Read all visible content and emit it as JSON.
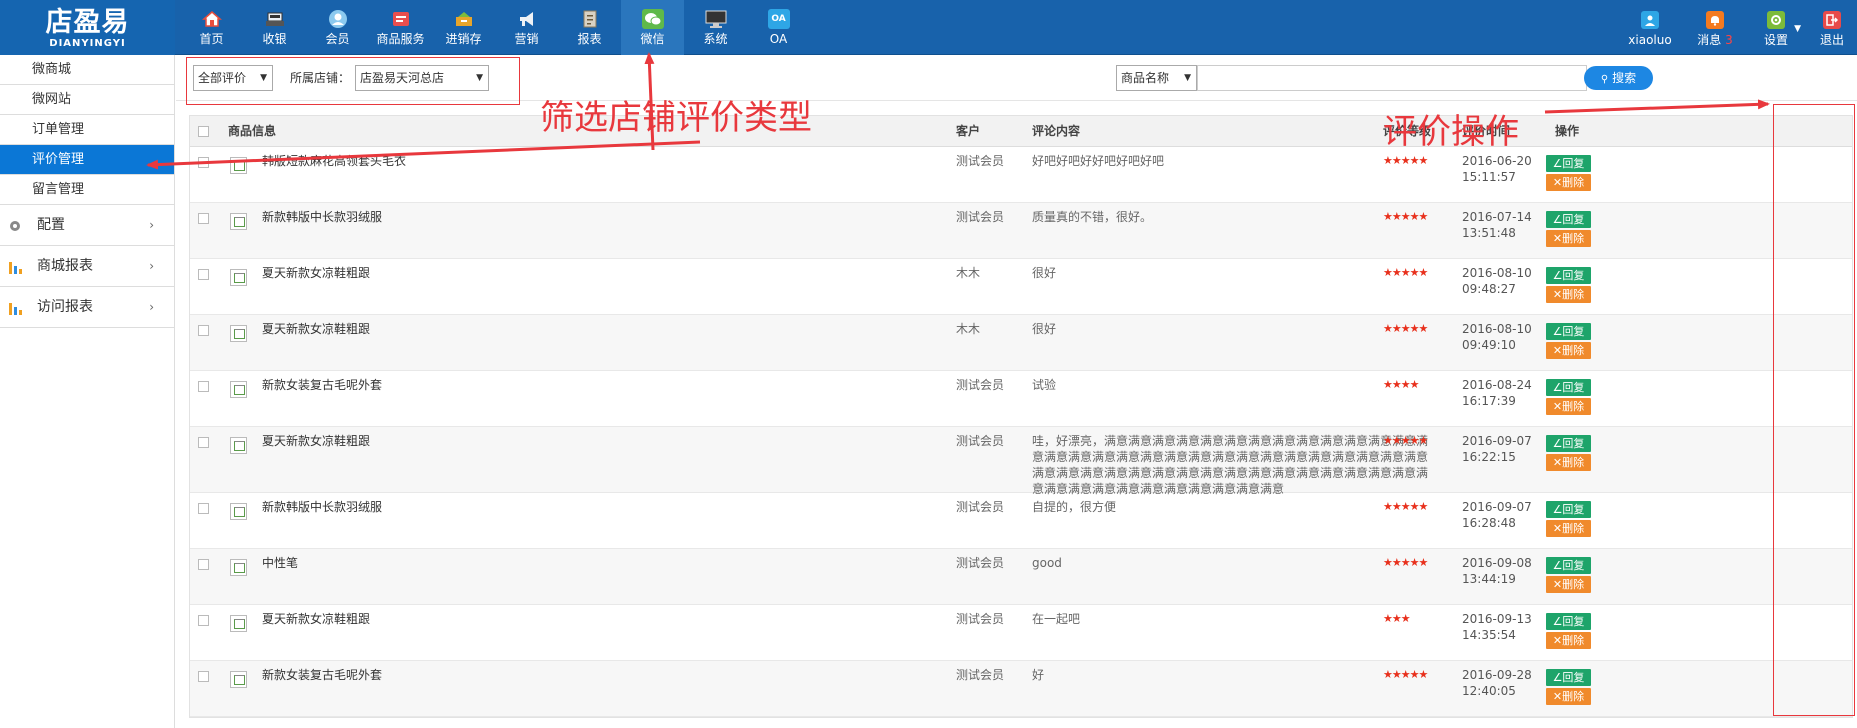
{
  "logo": {
    "cn": "店盈易",
    "en": "DIANYINGYI"
  },
  "nav": [
    {
      "label": "首页",
      "icon": "home-icon",
      "color": "#e94e3c"
    },
    {
      "label": "收银",
      "icon": "cash-register-icon",
      "color": "#dfe6ee"
    },
    {
      "label": "会员",
      "icon": "member-icon",
      "color": "#7fc0e8"
    },
    {
      "label": "商品服务",
      "icon": "goods-icon",
      "color": "#e94e4e"
    },
    {
      "label": "进销存",
      "icon": "inventory-icon",
      "color": "#e8a52a"
    },
    {
      "label": "营销",
      "icon": "megaphone-icon",
      "color": "#eef2f6"
    },
    {
      "label": "报表",
      "icon": "report-icon",
      "color": "#d9d2c4"
    },
    {
      "label": "微信",
      "icon": "wechat-icon",
      "color": "#5fb94a"
    },
    {
      "label": "系统",
      "icon": "monitor-icon",
      "color": "#333333"
    },
    {
      "label": "OA",
      "icon": "oa-icon",
      "color": "#2ea6e6"
    }
  ],
  "user": {
    "name": "xiaoluo",
    "messages_label": "消息",
    "messages_count": "3",
    "settings_label": "设置",
    "logout_label": "退出"
  },
  "sidebar": {
    "items": [
      {
        "label": "微商城",
        "active": false
      },
      {
        "label": "微网站",
        "active": false
      },
      {
        "label": "订单管理",
        "active": false
      },
      {
        "label": "评价管理",
        "active": true
      },
      {
        "label": "留言管理",
        "active": false
      }
    ],
    "groups": [
      {
        "label": "配置",
        "icon": "gear-icon"
      },
      {
        "label": "商城报表",
        "icon": "bar-chart-icon"
      },
      {
        "label": "访问报表",
        "icon": "bar-chart-icon"
      }
    ]
  },
  "filters": {
    "rating_type": "全部评价",
    "store_label": "所属店铺：",
    "store_value": "店盈易天河总店",
    "search_field": "商品名称",
    "search_value": "",
    "search_button": "搜索"
  },
  "table": {
    "headers": {
      "product": "商品信息",
      "customer": "客户",
      "comment": "评论内容",
      "rating": "评价等级",
      "time": "评价时间",
      "action": "操作"
    },
    "reply_label": "∠回复",
    "delete_label": "✕删除",
    "rows": [
      {
        "product": "韩版短款麻花高领套头毛衣",
        "customer": "测试会员",
        "comment": "好吧好吧好好吧好吧好吧",
        "stars": 5,
        "stars_text": "★★★★★",
        "time": "2016-06-20 15:11:57"
      },
      {
        "product": "新款韩版中长款羽绒服",
        "customer": "测试会员",
        "comment": "质量真的不错，很好。",
        "stars": 5,
        "stars_text": "★★★★★",
        "time": "2016-07-14 13:51:48"
      },
      {
        "product": "夏天新款女凉鞋粗跟",
        "customer": "木木",
        "comment": "很好",
        "stars": 5,
        "stars_text": "★★★★★",
        "time": "2016-08-10 09:48:27"
      },
      {
        "product": "夏天新款女凉鞋粗跟",
        "customer": "木木",
        "comment": "很好",
        "stars": 5,
        "stars_text": "★★★★★",
        "time": "2016-08-10 09:49:10"
      },
      {
        "product": "新款女装复古毛呢外套",
        "customer": "测试会员",
        "comment": "试验",
        "stars": 4,
        "stars_text": "★★★★",
        "time": "2016-08-24 16:17:39"
      },
      {
        "product": "夏天新款女凉鞋粗跟",
        "customer": "测试会员",
        "comment": "哇，好漂亮，满意满意满意满意满意满意满意满意满意满意满意满意满意满意满意满意满意满意满意满意满意满意满意满意满意满意满意满意满意满意满意满意满意满意满意满意满意满意满意满意满意满意满意满意满意满意满意满意满意满意满意满意满意满意满意满意满意",
        "stars": 5,
        "stars_text": "★★★★★",
        "time": "2016-09-07 16:22:15"
      },
      {
        "product": "新款韩版中长款羽绒服",
        "customer": "测试会员",
        "comment": "自提的，很方便",
        "stars": 5,
        "stars_text": "★★★★★",
        "time": "2016-09-07 16:28:48"
      },
      {
        "product": "中性笔",
        "customer": "测试会员",
        "comment": "good",
        "stars": 5,
        "stars_text": "★★★★★",
        "time": "2016-09-08 13:44:19"
      },
      {
        "product": "夏天新款女凉鞋粗跟",
        "customer": "测试会员",
        "comment": "在一起吧",
        "stars": 3,
        "stars_text": "★★★",
        "time": "2016-09-13 14:35:54"
      },
      {
        "product": "新款女装复古毛呢外套",
        "customer": "测试会员",
        "comment": "好",
        "stars": 5,
        "stars_text": "★★★★★",
        "time": "2016-09-28 12:40:05"
      }
    ]
  },
  "annotations": {
    "filter_note": "筛选店铺评价类型",
    "action_note": "评价操作"
  },
  "colors": {
    "topbar": "#1862ab",
    "active_side": "#0b77d6",
    "annotation_red": "#e8383d",
    "reply_green": "#1ea46a",
    "delete_orange": "#f08a2c",
    "star_red": "#e8301c"
  }
}
